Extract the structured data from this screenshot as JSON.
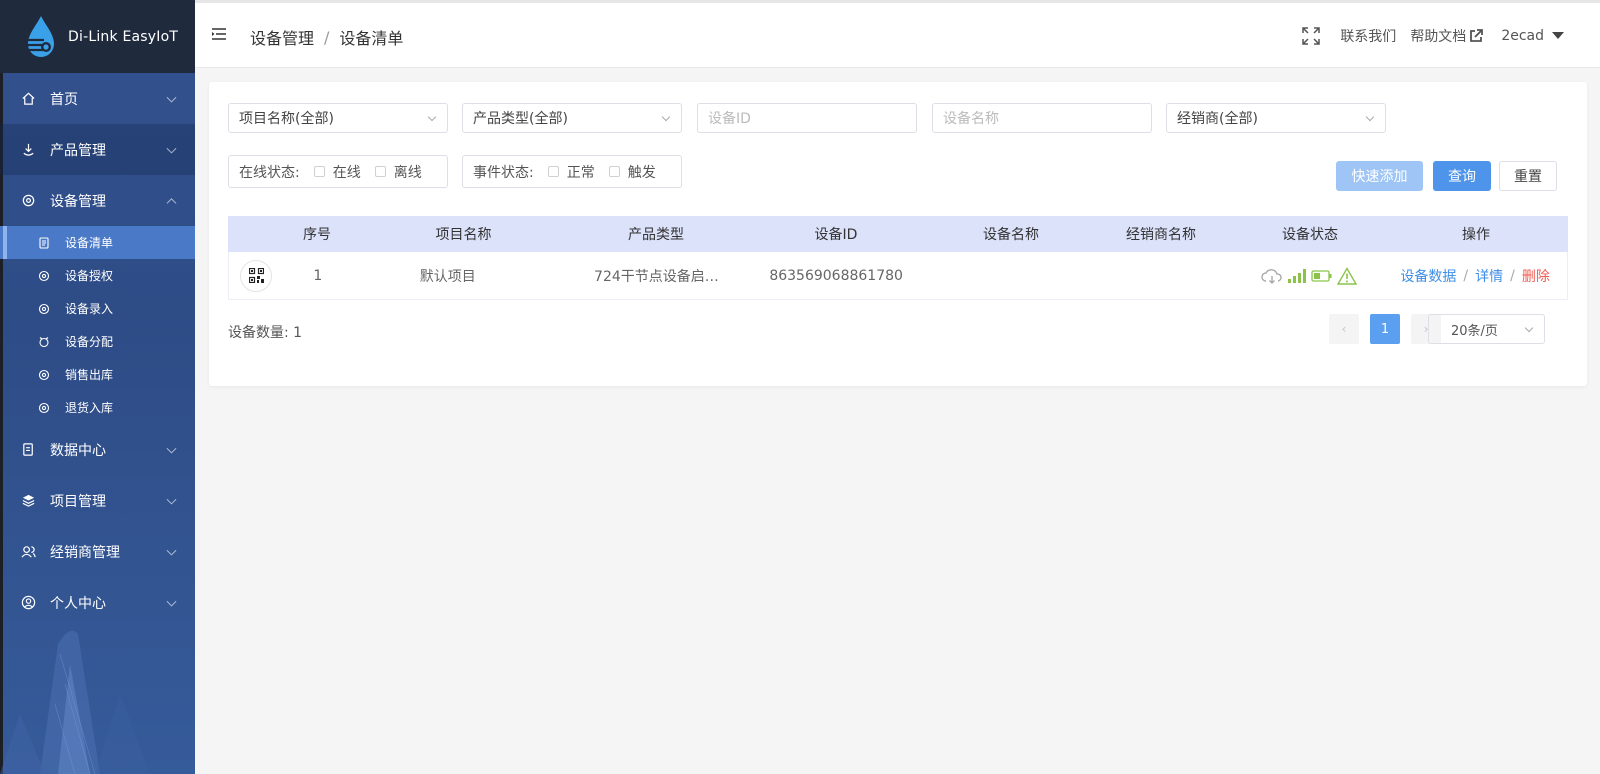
{
  "app": {
    "logo_text": "Di-Link EasyIoT"
  },
  "sidebar": {
    "items": [
      {
        "label": "首页",
        "icon": "home-icon"
      },
      {
        "label": "产品管理",
        "icon": "product-icon"
      },
      {
        "label": "设备管理",
        "icon": "device-icon",
        "expanded": true
      },
      {
        "label": "数据中心",
        "icon": "data-icon"
      },
      {
        "label": "项目管理",
        "icon": "layers-icon"
      },
      {
        "label": "经销商管理",
        "icon": "dealer-icon"
      },
      {
        "label": "个人中心",
        "icon": "user-icon"
      }
    ],
    "sub_items": [
      {
        "label": "设备清单",
        "active": true
      },
      {
        "label": "设备授权"
      },
      {
        "label": "设备录入"
      },
      {
        "label": "设备分配"
      },
      {
        "label": "销售出库"
      },
      {
        "label": "退货入库"
      }
    ]
  },
  "header": {
    "breadcrumb": [
      "设备管理",
      "设备清单"
    ],
    "breadcrumb_sep": "/",
    "contact": "联系我们",
    "help": "帮助文档",
    "user": "2ecad"
  },
  "filters": {
    "project_select": "项目名称(全部)",
    "product_select": "产品类型(全部)",
    "device_id_placeholder": "设备ID",
    "device_name_placeholder": "设备名称",
    "dealer_select": "经销商(全部)",
    "online_label": "在线状态:",
    "online_opt1": "在线",
    "online_opt2": "离线",
    "event_label": "事件状态:",
    "event_opt1": "正常",
    "event_opt2": "触发"
  },
  "buttons": {
    "quick_add": "快速添加",
    "query": "查询",
    "reset": "重置"
  },
  "table": {
    "headers": [
      "",
      "序号",
      "项目名称",
      "产品类型",
      "设备ID",
      "设备名称",
      "经销商名称",
      "设备状态",
      "操作"
    ],
    "rows": [
      {
        "index": "1",
        "project": "默认项目",
        "product": "724干节点设备启…",
        "device_id": "863569068861780",
        "device_name": "",
        "dealer": ""
      }
    ],
    "ops": {
      "data": "设备数据",
      "detail": "详情",
      "delete": "删除",
      "sep": "/"
    }
  },
  "footer": {
    "count_label": "设备数量: 1",
    "current_page": "1",
    "page_size": "20条/页",
    "prev": "‹",
    "next": "›"
  },
  "colors": {
    "primary": "#4d94ea",
    "danger": "#f05b52",
    "sidebar": "#33528f",
    "table_header": "#dbe2fa"
  }
}
